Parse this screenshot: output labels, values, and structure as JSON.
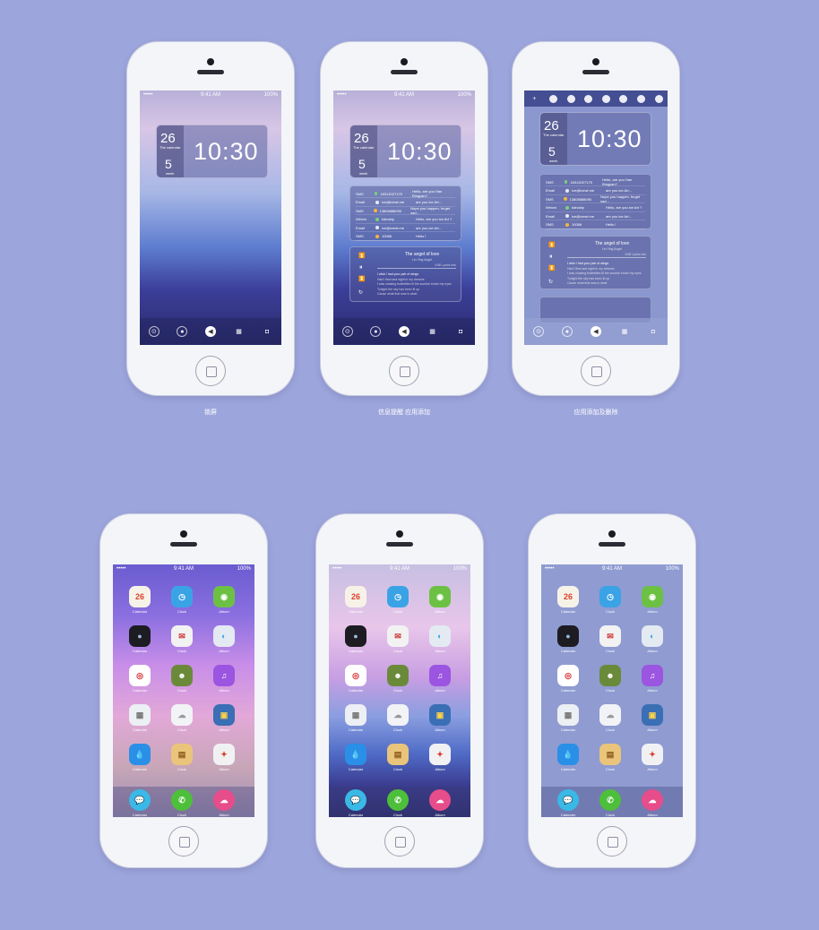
{
  "captions": [
    "锁屏",
    "信息提醒 应用添加",
    "应用添加及删除"
  ],
  "status": {
    "carrier": "•••••",
    "time": "9:41 AM",
    "battery": "100%"
  },
  "clock_widget": {
    "day": "26",
    "day_label": "The calendar",
    "week": "5",
    "week_label": "week",
    "time": "10:30"
  },
  "messages": [
    {
      "type": "SMS",
      "name": "18312027175",
      "text": "Hello, are you Han Bingyan?",
      "color": "#7ad17a"
    },
    {
      "type": "Email",
      "name": "Ice@icewt.me",
      "text": "are you ice Art...",
      "color": "#e8eaf6"
    },
    {
      "type": "SMS",
      "name": "13808888090",
      "text": "Nope you happen, forget sad...",
      "color": "#f5b63c"
    },
    {
      "type": "Weixin",
      "name": "kahobiy",
      "text": "Hello, are you ice Art ?",
      "color": "#7ad17a"
    },
    {
      "type": "Email",
      "name": "ice@icewt.me",
      "text": "are you ice Art...",
      "color": "#e8eaf6"
    },
    {
      "type": "SMS",
      "name": "10086",
      "text": "Hello !",
      "color": "#f5b63c"
    }
  ],
  "music": {
    "title": "The angel of love",
    "artist": "Lin Ying Angel",
    "time": "4:58",
    "lyric_label": "Lyrics info",
    "lyrics": [
      "I wish I had your pair of wings",
      "Had I flew last night in my dreams",
      "I was chasing butterflies til the sunrise broke my eyes",
      "Tonight the sky has been lit up",
      "Cause what that was is what"
    ]
  },
  "apps": [
    {
      "label": "Calendar",
      "color": "#f7f2e8",
      "fg": "#d9402c",
      "glyph": "26"
    },
    {
      "label": "Clock",
      "color": "#3aa3e6",
      "fg": "#fff",
      "glyph": "◷"
    },
    {
      "label": "Album",
      "color": "#6cc144",
      "fg": "#fff",
      "glyph": "◉"
    },
    {
      "label": "Calendar",
      "color": "#1c1c22",
      "fg": "#9bd",
      "glyph": "●"
    },
    {
      "label": "Clock",
      "color": "#f2f2f2",
      "fg": "#c33",
      "glyph": "✉"
    },
    {
      "label": "Album",
      "color": "#e4eaf2",
      "fg": "#3aa3e6",
      "glyph": "◐"
    },
    {
      "label": "Calendar",
      "color": "#ffffff",
      "fg": "#d0282e",
      "glyph": "◎"
    },
    {
      "label": "Clock",
      "color": "#6a8a3a",
      "fg": "#fff",
      "glyph": "☻"
    },
    {
      "label": "Album",
      "color": "#9b55e0",
      "fg": "#fff",
      "glyph": "♫"
    },
    {
      "label": "Calendar",
      "color": "#eceff3",
      "fg": "#777",
      "glyph": "▦"
    },
    {
      "label": "Clock",
      "color": "#f2f3f6",
      "fg": "#999",
      "glyph": "☁"
    },
    {
      "label": "Album",
      "color": "#3a6fb5",
      "fg": "#ffd24a",
      "glyph": "▣"
    },
    {
      "label": "Calendar",
      "color": "#2a8fe6",
      "fg": "#fff",
      "glyph": "💧"
    },
    {
      "label": "Clock",
      "color": "#e9c47a",
      "fg": "#8a5a1a",
      "glyph": "▤"
    },
    {
      "label": "Album",
      "color": "#f1f1f4",
      "fg": "#d94030",
      "glyph": "✦"
    }
  ],
  "dock_apps": [
    {
      "label": "Calendar",
      "color": "#3ab8e6",
      "fg": "#fff",
      "glyph": "💬"
    },
    {
      "label": "Clock",
      "color": "#4dbf3a",
      "fg": "#fff",
      "glyph": "✆"
    },
    {
      "label": "Album",
      "color": "#e64d8a",
      "fg": "#fff",
      "glyph": "☁"
    }
  ]
}
